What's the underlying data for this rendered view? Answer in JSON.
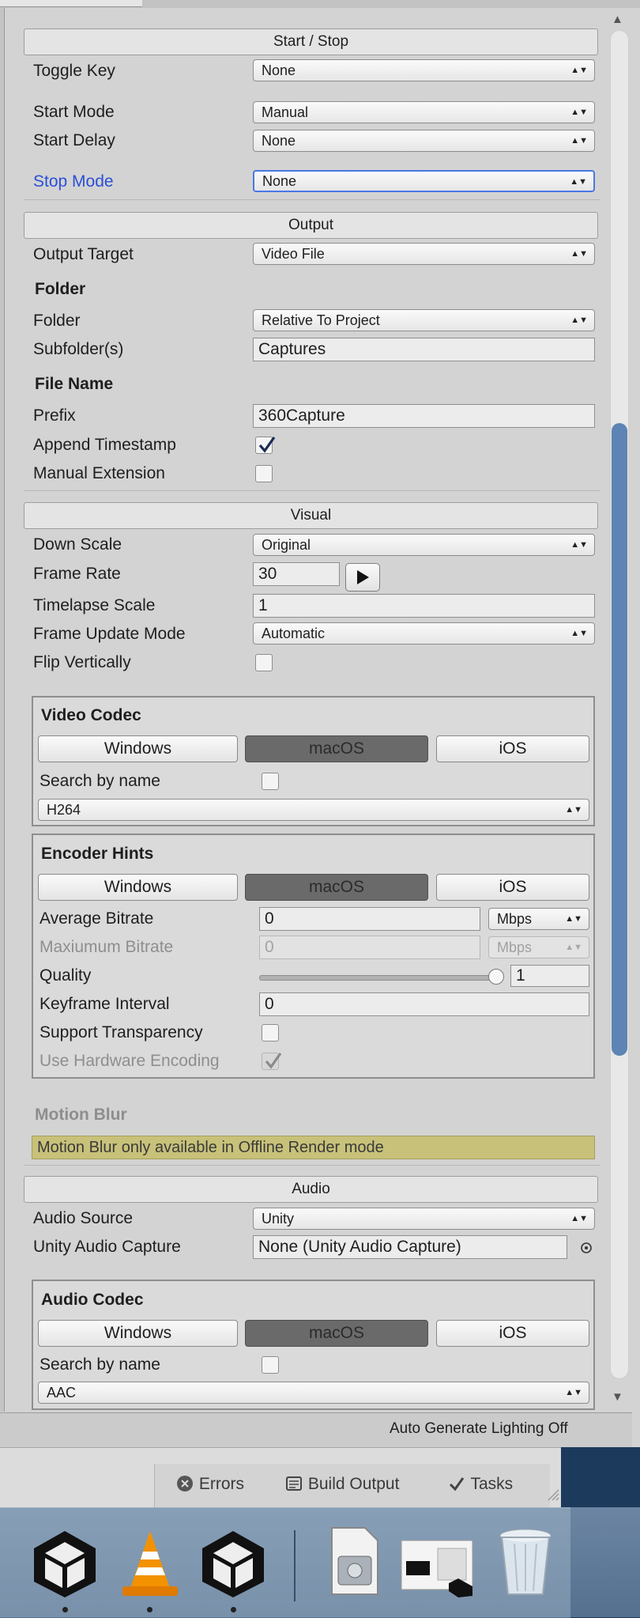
{
  "sections": {
    "start_stop": "Start / Stop",
    "output": "Output",
    "visual": "Visual",
    "audio": "Audio"
  },
  "start_stop": {
    "toggle_key": {
      "label": "Toggle Key",
      "value": "None"
    },
    "start_mode": {
      "label": "Start Mode",
      "value": "Manual"
    },
    "start_delay": {
      "label": "Start Delay",
      "value": "None"
    },
    "stop_mode": {
      "label": "Stop Mode",
      "value": "None"
    }
  },
  "output": {
    "output_target": {
      "label": "Output Target",
      "value": "Video File"
    },
    "folder_header": "Folder",
    "folder": {
      "label": "Folder",
      "value": "Relative To Project"
    },
    "subfolders": {
      "label": "Subfolder(s)",
      "value": "Captures"
    },
    "file_name_header": "File Name",
    "prefix": {
      "label": "Prefix",
      "value": "360Capture"
    },
    "append_timestamp": {
      "label": "Append Timestamp",
      "checked": true
    },
    "manual_extension": {
      "label": "Manual Extension",
      "checked": false
    }
  },
  "visual": {
    "down_scale": {
      "label": "Down Scale",
      "value": "Original"
    },
    "frame_rate": {
      "label": "Frame Rate",
      "value": "30"
    },
    "timelapse_scale": {
      "label": "Timelapse Scale",
      "value": "1"
    },
    "frame_update_mode": {
      "label": "Frame Update Mode",
      "value": "Automatic"
    },
    "flip_vertically": {
      "label": "Flip Vertically",
      "checked": false
    }
  },
  "platform_tabs": [
    "Windows",
    "macOS",
    "iOS"
  ],
  "video_codec": {
    "header": "Video Codec",
    "search_by_name": "Search by name",
    "codec": "H264"
  },
  "encoder_hints": {
    "header": "Encoder Hints",
    "average_bitrate": {
      "label": "Average Bitrate",
      "value": "0",
      "unit": "Mbps"
    },
    "maximum_bitrate": {
      "label": "Maxiumum Bitrate",
      "value": "0",
      "unit": "Mbps"
    },
    "quality": {
      "label": "Quality",
      "value": "1",
      "level": 1.0
    },
    "keyframe_interval": {
      "label": "Keyframe Interval",
      "value": "0"
    },
    "support_transparency": {
      "label": "Support Transparency",
      "checked": false
    },
    "use_hardware_encoding": {
      "label": "Use Hardware Encoding",
      "checked": true
    }
  },
  "motion_blur": {
    "header": "Motion Blur",
    "warning": "Motion Blur only available in Offline Render mode"
  },
  "audio": {
    "audio_source": {
      "label": "Audio Source",
      "value": "Unity"
    },
    "unity_audio_capture": {
      "label": "Unity Audio Capture",
      "value": "None (Unity Audio Capture)"
    }
  },
  "audio_codec": {
    "header": "Audio Codec",
    "search_by_name": "Search by name",
    "codec": "AAC"
  },
  "status_bar": "Auto Generate Lighting Off",
  "console_tabs": {
    "errors": "Errors",
    "build_output": "Build Output",
    "tasks": "Tasks"
  },
  "colors": {
    "accent_blue": "#2a4fd6",
    "selected_tab": "#6a6a6a",
    "warning_bg": "#c8c17a",
    "scrollbar": "#5d84b4"
  }
}
